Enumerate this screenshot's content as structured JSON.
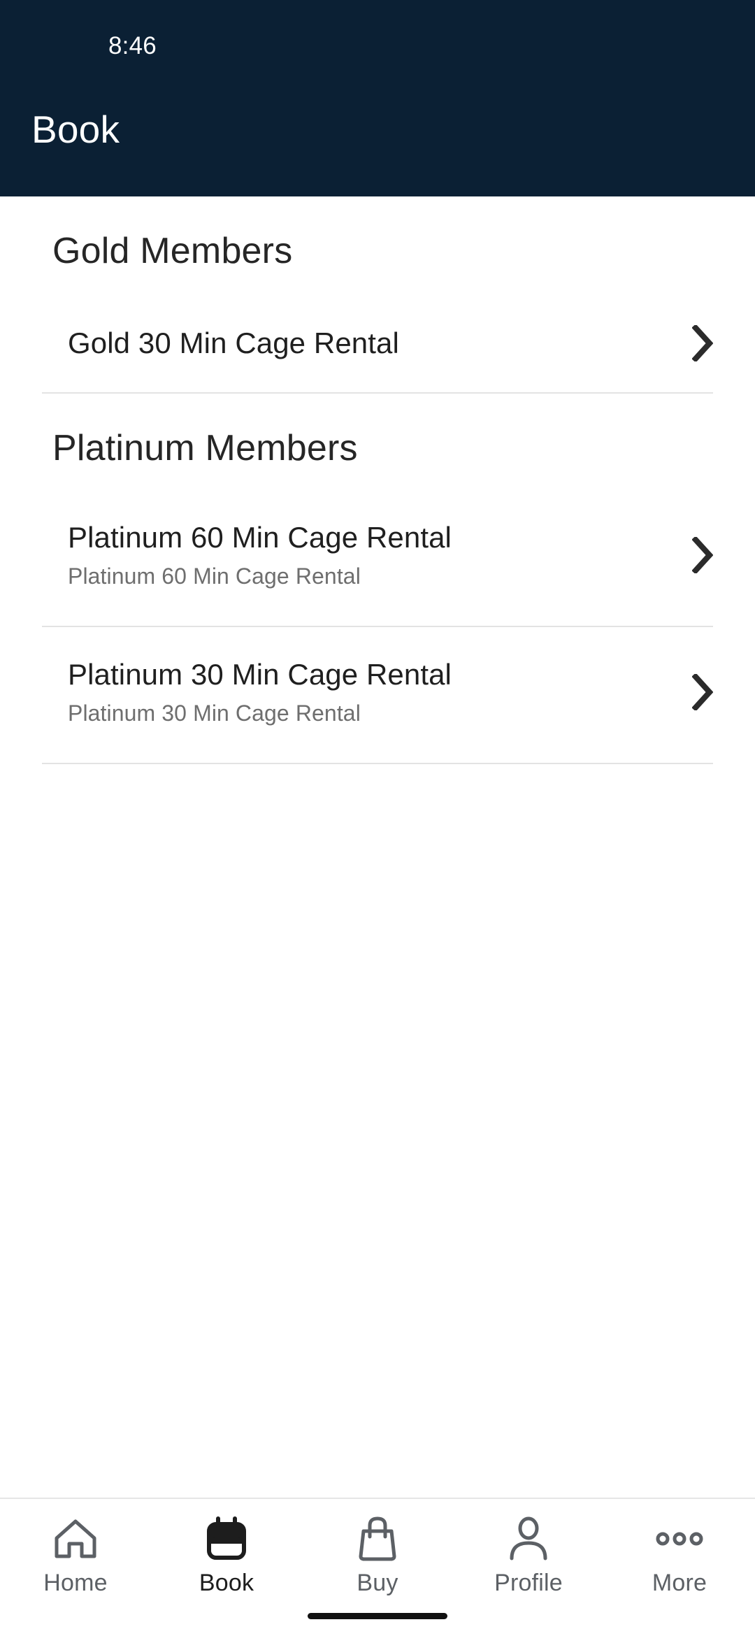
{
  "status_bar": {
    "time": "8:46"
  },
  "header": {
    "title": "Book",
    "background_color": "#0B2034",
    "text_color": "#FFFFFF"
  },
  "main": {
    "sections": [
      {
        "title": "Gold Members",
        "items": [
          {
            "title": "Gold 30 Min Cage Rental",
            "subtitle": "",
            "chevron": "chevron-right-icon"
          }
        ]
      },
      {
        "title": "Platinum Members",
        "items": [
          {
            "title": "Platinum 60 Min Cage Rental",
            "subtitle": "Platinum 60 Min Cage Rental",
            "chevron": "chevron-right-icon"
          },
          {
            "title": "Platinum 30 Min Cage Rental",
            "subtitle": "Platinum 30 Min Cage Rental",
            "chevron": "chevron-right-icon"
          }
        ]
      }
    ]
  },
  "bottom_nav": {
    "active": "Book",
    "items": [
      {
        "label": "Home",
        "icon": "home-icon",
        "active": false
      },
      {
        "label": "Book",
        "icon": "calendar-icon",
        "active": true
      },
      {
        "label": "Buy",
        "icon": "bag-icon",
        "active": false
      },
      {
        "label": "Profile",
        "icon": "person-icon",
        "active": false
      },
      {
        "label": "More",
        "icon": "ellipsis-icon",
        "active": false
      }
    ]
  },
  "colors": {
    "header_bg": "#0B2034",
    "divider": "#E3E3E3",
    "title_text": "#1F1F1F",
    "subtitle_text": "#6E6E6E",
    "nav_inactive": "#5C6065",
    "nav_active": "#1D1D1D"
  }
}
